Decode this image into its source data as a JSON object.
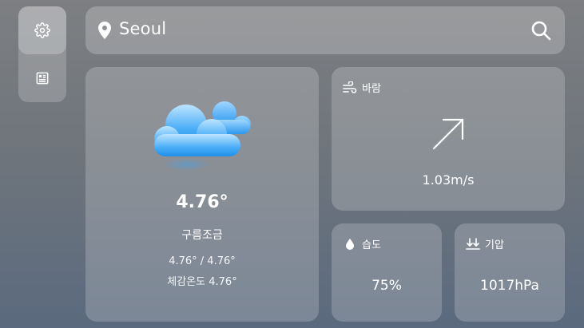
{
  "sidebar": {
    "items": [
      {
        "icon": "gear-icon",
        "active": true
      },
      {
        "icon": "newspaper-icon",
        "active": false
      }
    ]
  },
  "search": {
    "city": "Seoul",
    "pin_icon": "location-pin-icon",
    "search_icon": "search-icon"
  },
  "weather": {
    "icon": "partly-cloudy-icon",
    "temperature": "4.76°",
    "description": "구름조금",
    "min_max": "4.76° / 4.76°",
    "feels_like": "체감온도 4.76°"
  },
  "wind": {
    "title": "바람",
    "icon": "wind-icon",
    "direction_icon": "arrow-up-right-icon",
    "value": "1.03m/s"
  },
  "humidity": {
    "title": "습도",
    "icon": "droplet-icon",
    "value": "75%"
  },
  "pressure": {
    "title": "기압",
    "icon": "pressure-icon",
    "value": "1017hPa"
  },
  "colors": {
    "card_bg": "rgba(255,255,255,0.20)",
    "text": "#ffffff",
    "cloud_blue": "#3aa5f5"
  }
}
